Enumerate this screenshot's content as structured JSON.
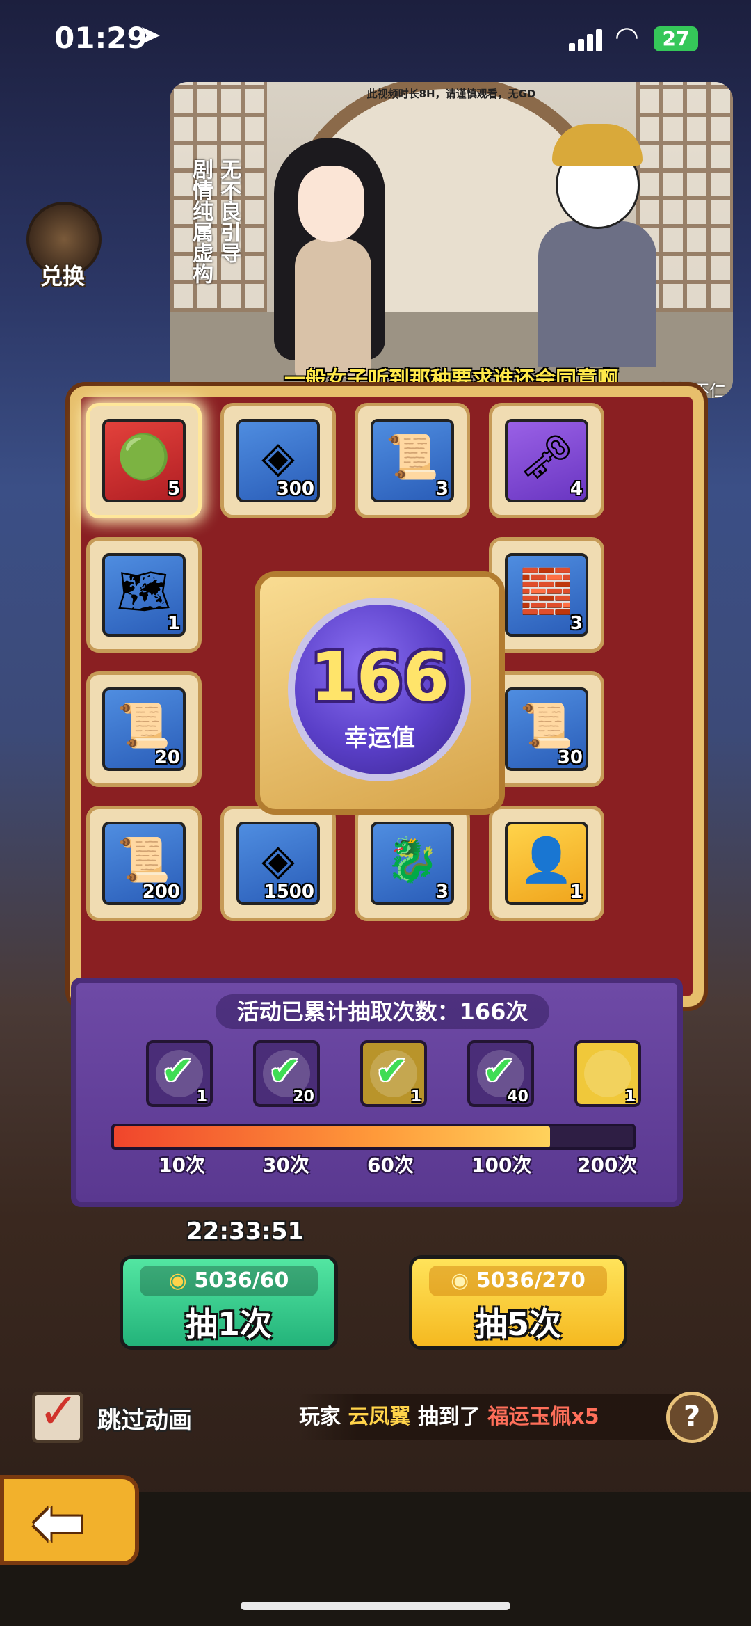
{
  "status_bar": {
    "time": "01:29",
    "battery": "27"
  },
  "video": {
    "top_text": "此视频时长8H，请谨慎观看，无GD",
    "side_text_1": "无不良引导",
    "side_text_2": "剧情纯属虚构",
    "subtitle": "一般女子听到那种要求谁还会同意啊",
    "watermark": "@虾虾不仁"
  },
  "exchange": {
    "label": "兑换"
  },
  "board": {
    "cells": [
      {
        "count": "5",
        "color": "red",
        "icon": "jade-pendant-icon",
        "glyph": "🟢"
      },
      {
        "count": "300",
        "color": "blue",
        "icon": "copper-coin-icon",
        "glyph": "◈"
      },
      {
        "count": "3",
        "color": "blue",
        "icon": "mystery-scroll-icon",
        "glyph": "📜"
      },
      {
        "count": "4",
        "color": "purple",
        "icon": "golden-key-icon",
        "glyph": "🗝"
      },
      {
        "count": "1",
        "color": "blue",
        "icon": "map-scroll-icon",
        "glyph": "🗺"
      },
      {
        "count": "3",
        "color": "blue",
        "icon": "stone-blocks-icon",
        "glyph": "🧱"
      },
      {
        "count": "20",
        "color": "blue",
        "icon": "mystery-scroll-icon",
        "glyph": "📜"
      },
      {
        "count": "30",
        "color": "blue",
        "icon": "red-mystery-scroll-icon",
        "glyph": "📜"
      },
      {
        "count": "200",
        "color": "blue",
        "icon": "red-mystery-scroll-icon",
        "glyph": "📜"
      },
      {
        "count": "1500",
        "color": "blue",
        "icon": "copper-coin-icon",
        "glyph": "◈"
      },
      {
        "count": "3",
        "color": "blue",
        "icon": "jade-beast-icon",
        "glyph": "🐉"
      },
      {
        "count": "1",
        "color": "gold",
        "icon": "hero-portrait-icon",
        "glyph": "👤"
      }
    ],
    "luck_value": "166",
    "luck_label": "幸运值"
  },
  "progress": {
    "title": "活动已累计抽取次数：166次",
    "fraction": 0.84,
    "milestones": [
      {
        "count": "1",
        "claimed": true,
        "icon": "beast-statue-icon"
      },
      {
        "count": "20",
        "claimed": true,
        "icon": "copper-coin-icon"
      },
      {
        "count": "1",
        "claimed": true,
        "icon": "hero-portrait-icon"
      },
      {
        "count": "40",
        "claimed": true,
        "icon": "copper-coin-icon"
      },
      {
        "count": "1",
        "claimed": false,
        "icon": "armor-icon"
      }
    ],
    "ticks": [
      "10次",
      "30次",
      "60次",
      "100次",
      "200次"
    ]
  },
  "timer": "22:33:51",
  "draw1": {
    "cost": "5036/60",
    "label": "抽1次"
  },
  "draw5": {
    "cost": "5036/270",
    "label": "抽5次"
  },
  "skip": {
    "label": "跳过动画",
    "checked": true
  },
  "ticker": {
    "prefix": "玩家",
    "player": "云凤翼",
    "mid": "抽到了",
    "prize": "福运玉佩x5"
  },
  "colors": {
    "accent_green": "#23b37a",
    "accent_yellow": "#f5b920",
    "panel_purple": "#5a3890"
  }
}
